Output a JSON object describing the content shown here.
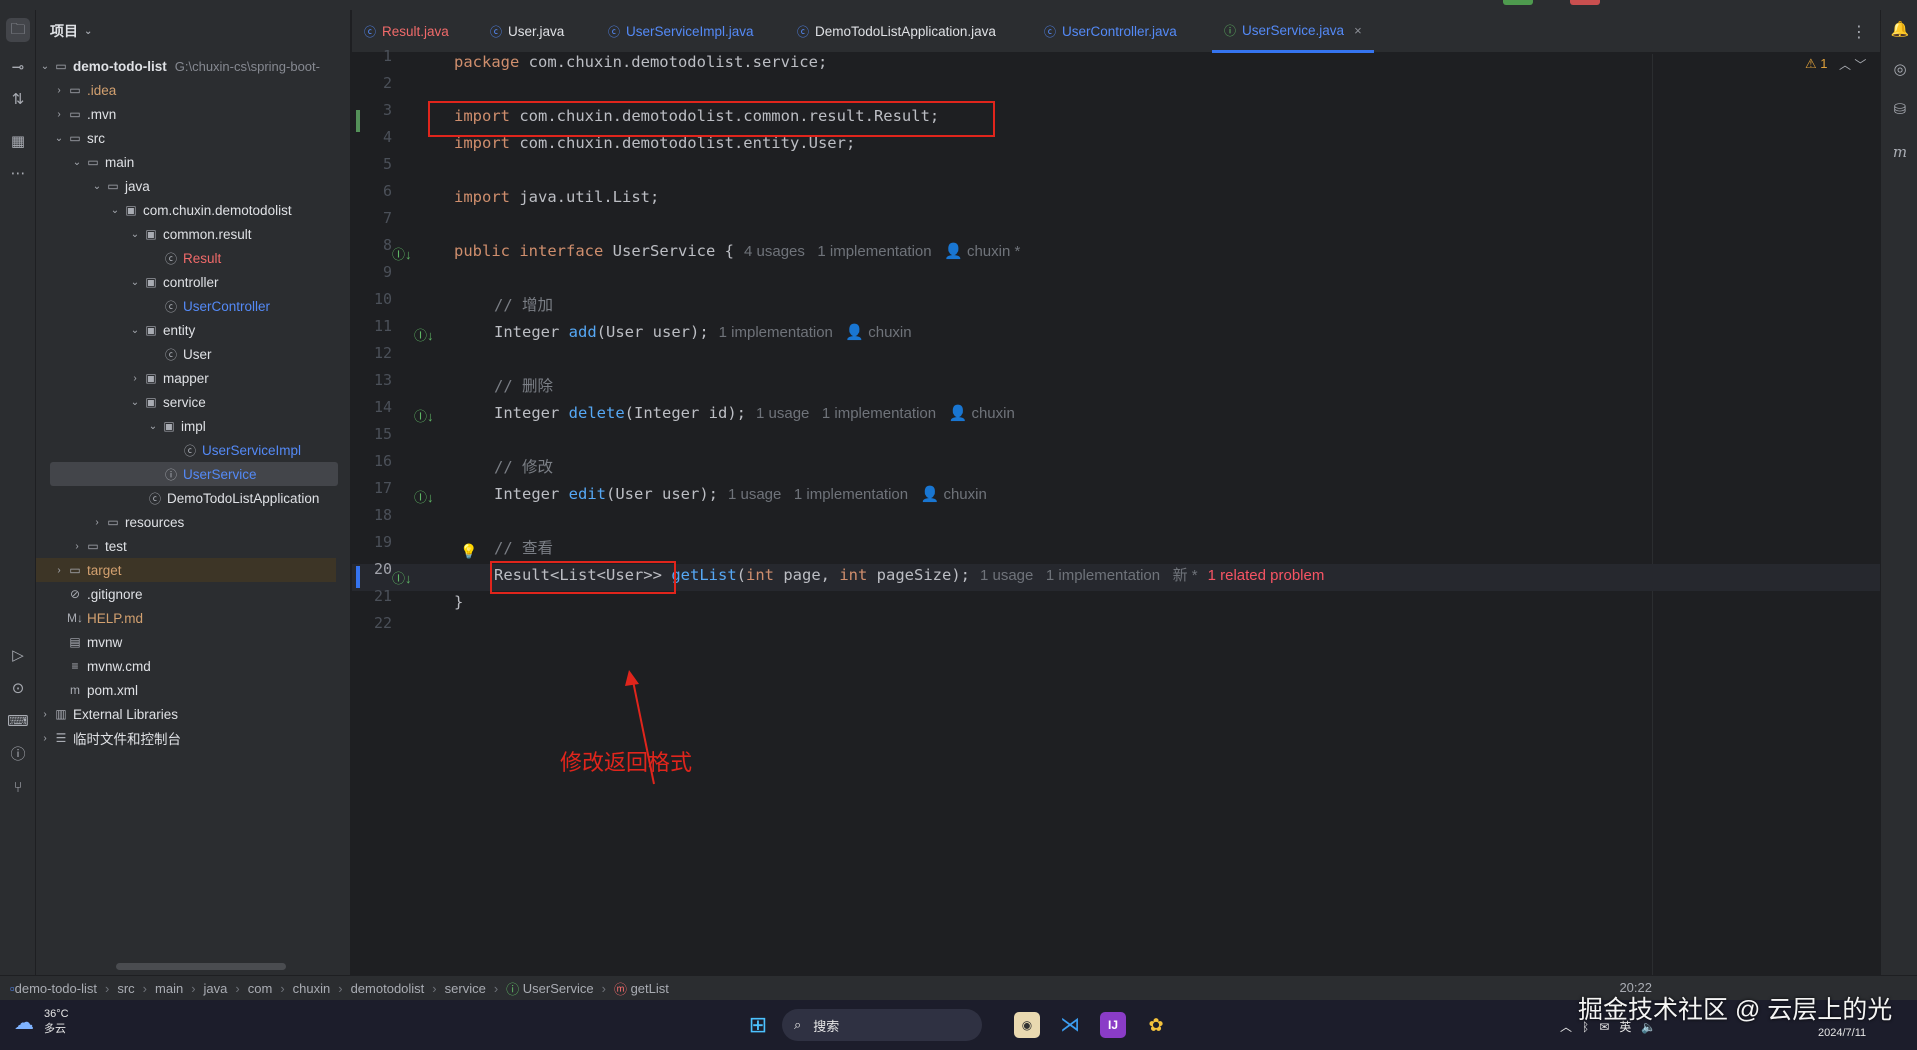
{
  "project_panel": {
    "title": "项目",
    "root": "demo-todo-list",
    "root_path": "G:\\chuxin-cs\\spring-boot-",
    "items": [
      {
        "label": ".idea"
      },
      {
        "label": ".mvn"
      },
      {
        "label": "src"
      },
      {
        "label": "main"
      },
      {
        "label": "java"
      },
      {
        "label": "com.chuxin.demotodolist"
      },
      {
        "label": "common.result"
      },
      {
        "label": "Result"
      },
      {
        "label": "controller"
      },
      {
        "label": "UserController"
      },
      {
        "label": "entity"
      },
      {
        "label": "User"
      },
      {
        "label": "mapper"
      },
      {
        "label": "service"
      },
      {
        "label": "impl"
      },
      {
        "label": "UserServiceImpl"
      },
      {
        "label": "UserService"
      },
      {
        "label": "DemoTodoListApplication"
      },
      {
        "label": "resources"
      },
      {
        "label": "test"
      },
      {
        "label": "target"
      },
      {
        "label": ".gitignore"
      },
      {
        "label": "HELP.md"
      },
      {
        "label": "mvnw"
      },
      {
        "label": "mvnw.cmd"
      },
      {
        "label": "pom.xml"
      },
      {
        "label": "External Libraries"
      },
      {
        "label": "临时文件和控制台"
      }
    ]
  },
  "tabs": [
    {
      "label": "Result.java"
    },
    {
      "label": "User.java"
    },
    {
      "label": "UserServiceImpl.java"
    },
    {
      "label": "DemoTodoListApplication.java"
    },
    {
      "label": "UserController.java"
    },
    {
      "label": "UserService.java"
    }
  ],
  "editor": {
    "warnings": "1",
    "lines": {
      "l1": {
        "kw": "package",
        "rest": " com.chuxin.demotodolist.service;"
      },
      "l3": {
        "kw": "import",
        "rest": " com.chuxin.demotodolist.common.result.Result;"
      },
      "l4": {
        "kw": "import",
        "rest": " com.chuxin.demotodolist.entity.User;"
      },
      "l6": {
        "kw": "import",
        "rest": " java.util.List;"
      },
      "l8": {
        "kw1": "public",
        "kw2": "interface",
        "rest": " UserService {",
        "hint": "4 usages   1 implementation   👤 chuxin *"
      },
      "l10": {
        "comment": "// 增加"
      },
      "l11": {
        "type": "Integer",
        "fn": "add",
        "params": "(User user);",
        "hint": "1 implementation   👤 chuxin"
      },
      "l13": {
        "comment": "// 删除"
      },
      "l14": {
        "type": "Integer",
        "fn": "delete",
        "params": "(Integer id);",
        "hint": "1 usage   1 implementation   👤 chuxin"
      },
      "l16": {
        "comment": "// 修改"
      },
      "l17": {
        "type": "Integer",
        "fn": "edit",
        "params": "(User user);",
        "hint": "1 usage   1 implementation   👤 chuxin"
      },
      "l19": {
        "comment": "// 查看"
      },
      "l20": {
        "type": "Result<List<User>>",
        "fn": "getList",
        "p1": "(",
        "kw1": "int",
        "p2": " page, ",
        "kw2": "int",
        "p3": " pageSize);",
        "hint": "1 usage   1 implementation   新 *",
        "problem": "1 related problem"
      },
      "l21": {
        "text": "}"
      }
    }
  },
  "annotation": {
    "text": "修改返回格式"
  },
  "breadcrumb": [
    "demo-todo-list",
    "src",
    "main",
    "java",
    "com",
    "chuxin",
    "demotodolist",
    "service",
    "UserService",
    "getList"
  ],
  "status_right": "20:22",
  "taskbar": {
    "weather_temp": "36°C",
    "weather_desc": "多云",
    "search_placeholder": "搜索",
    "tray_lang": "英",
    "clock_date": "2024/7/11"
  },
  "watermark": "掘金技术社区 @ 云层上的光"
}
